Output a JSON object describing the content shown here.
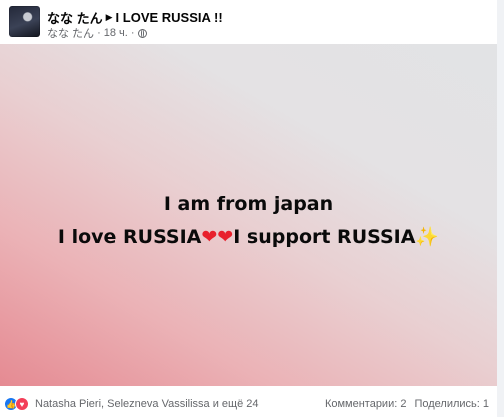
{
  "post": {
    "author": "なな たん",
    "group": "I LOVE RUSSIA !!",
    "meta_author": "なな たん",
    "time": "18 ч.",
    "separator": "·",
    "privacy_icon": "globe-icon"
  },
  "image": {
    "line1": "I am from japan",
    "line2_a": "I love RUSSIA",
    "line2_b": "I support RUSSIA",
    "heart": "❤",
    "sparkle": "✨"
  },
  "footer": {
    "reactors": "Natasha Pieri, Selezneva Vassilissa и ещё 24",
    "comments": "Комментарии: 2",
    "shares": "Поделились: 1",
    "reaction_icons": [
      "like-icon",
      "love-icon"
    ]
  },
  "colors": {
    "like": "#1877f2",
    "love": "#f33e58",
    "meta_text": "#65676b"
  }
}
